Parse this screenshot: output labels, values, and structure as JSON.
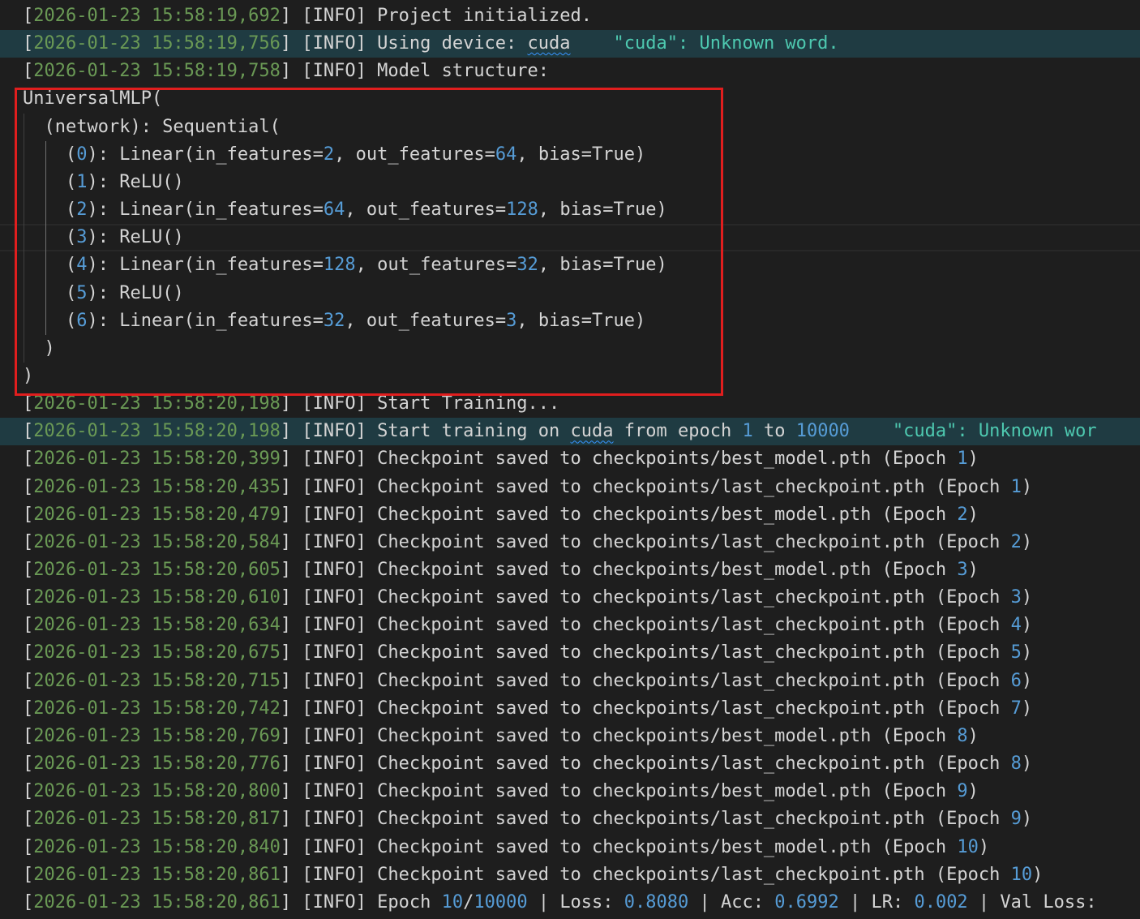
{
  "log": {
    "lines": [
      {
        "ts": "2026-01-23 15:58:19,692",
        "level": "INFO",
        "msg": "Project initialized."
      },
      {
        "ts": "2026-01-23 15:58:19,756",
        "level": "INFO",
        "msg_pre": "Using device: ",
        "msg_word": "cuda",
        "hint": "\"cuda\": Unknown word."
      },
      {
        "ts": "2026-01-23 15:58:19,758",
        "level": "INFO",
        "msg": "Model structure:"
      }
    ],
    "model": {
      "l0": "UniversalMLP(",
      "l1": "(network): Sequential(",
      "layers": [
        {
          "idx": "0",
          "a": "Linear(in_features=",
          "in": "2",
          "b": ", out_features=",
          "out": "64",
          "c": ", bias=True)"
        },
        {
          "idx": "1",
          "a": "ReLU()"
        },
        {
          "idx": "2",
          "a": "Linear(in_features=",
          "in": "64",
          "b": ", out_features=",
          "out": "128",
          "c": ", bias=True)"
        },
        {
          "idx": "3",
          "a": "ReLU()"
        },
        {
          "idx": "4",
          "a": "Linear(in_features=",
          "in": "128",
          "b": ", out_features=",
          "out": "32",
          "c": ", bias=True)"
        },
        {
          "idx": "5",
          "a": "ReLU()"
        },
        {
          "idx": "6",
          "a": "Linear(in_features=",
          "in": "32",
          "b": ", out_features=",
          "out": "3",
          "c": ", bias=True)"
        }
      ],
      "close1": ")",
      "close0": ")"
    },
    "start1": {
      "ts": "2026-01-23 15:58:20,198",
      "level": "INFO",
      "msg": "Start Training..."
    },
    "start2": {
      "ts": "2026-01-23 15:58:20,198",
      "level": "INFO",
      "pre": "Start training on ",
      "word": "cuda",
      "mid": " from epoch ",
      "e1": "1",
      "to": " to ",
      "e2": "10000",
      "hint": "\"cuda\": Unknown wor"
    },
    "checkpoints": [
      {
        "ts": "2026-01-23 15:58:20,399",
        "path": "checkpoints/best_model.pth",
        "epoch": "1"
      },
      {
        "ts": "2026-01-23 15:58:20,435",
        "path": "checkpoints/last_checkpoint.pth",
        "epoch": "1"
      },
      {
        "ts": "2026-01-23 15:58:20,479",
        "path": "checkpoints/best_model.pth",
        "epoch": "2"
      },
      {
        "ts": "2026-01-23 15:58:20,584",
        "path": "checkpoints/last_checkpoint.pth",
        "epoch": "2"
      },
      {
        "ts": "2026-01-23 15:58:20,605",
        "path": "checkpoints/best_model.pth",
        "epoch": "3"
      },
      {
        "ts": "2026-01-23 15:58:20,610",
        "path": "checkpoints/last_checkpoint.pth",
        "epoch": "3"
      },
      {
        "ts": "2026-01-23 15:58:20,634",
        "path": "checkpoints/last_checkpoint.pth",
        "epoch": "4"
      },
      {
        "ts": "2026-01-23 15:58:20,675",
        "path": "checkpoints/last_checkpoint.pth",
        "epoch": "5"
      },
      {
        "ts": "2026-01-23 15:58:20,715",
        "path": "checkpoints/last_checkpoint.pth",
        "epoch": "6"
      },
      {
        "ts": "2026-01-23 15:58:20,742",
        "path": "checkpoints/last_checkpoint.pth",
        "epoch": "7"
      },
      {
        "ts": "2026-01-23 15:58:20,769",
        "path": "checkpoints/best_model.pth",
        "epoch": "8"
      },
      {
        "ts": "2026-01-23 15:58:20,776",
        "path": "checkpoints/last_checkpoint.pth",
        "epoch": "8"
      },
      {
        "ts": "2026-01-23 15:58:20,800",
        "path": "checkpoints/best_model.pth",
        "epoch": "9"
      },
      {
        "ts": "2026-01-23 15:58:20,817",
        "path": "checkpoints/last_checkpoint.pth",
        "epoch": "9"
      },
      {
        "ts": "2026-01-23 15:58:20,840",
        "path": "checkpoints/best_model.pth",
        "epoch": "10"
      },
      {
        "ts": "2026-01-23 15:58:20,861",
        "path": "checkpoints/last_checkpoint.pth",
        "epoch": "10"
      }
    ],
    "checkpoint_label": "Checkpoint saved to ",
    "epoch_label": "Epoch ",
    "summary": {
      "ts": "2026-01-23 15:58:20,861",
      "level": "INFO",
      "epoch_label": "Epoch ",
      "epoch": "10",
      "total": "10000",
      "loss_label": "Loss: ",
      "loss": "0.8080",
      "acc_label": "Acc: ",
      "acc": "0.6992",
      "lr_label": "LR: ",
      "lr": "0.002",
      "val_label": "Val Loss:"
    }
  },
  "colors": {
    "background": "#1e1e1e",
    "timestamp": "#6a9955",
    "number": "#569cd6",
    "hint": "#4ec9b0",
    "highlight": "#1f3b42",
    "selection_border": "#e01e1e"
  }
}
